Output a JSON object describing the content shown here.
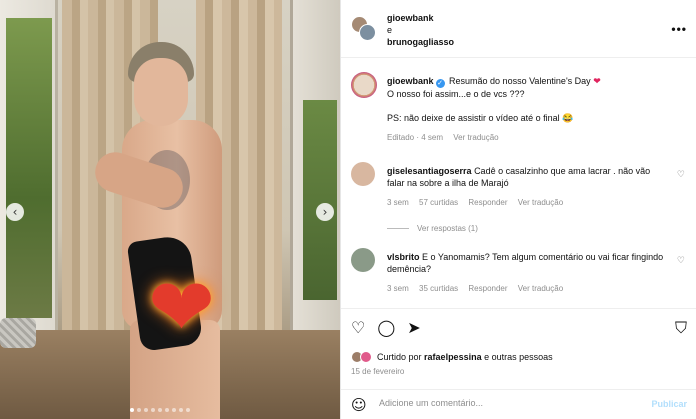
{
  "photo": {
    "prev_icon": "chevron-left-icon",
    "next_icon": "chevron-right-icon",
    "prev_glyph": "‹",
    "next_glyph": "›",
    "sticker_glyph": "❤",
    "sticker_icon": "heart-on-fire-sticker",
    "dot_count": 9,
    "active_dot": 0
  },
  "header": {
    "user1": "gioewbank",
    "connector": "e",
    "user2": "brunogagliasso",
    "more_glyph": "•••"
  },
  "caption": {
    "username": "gioewbank",
    "verified_glyph": "✓",
    "line1": "Resumão do nosso Valentine's Day",
    "heart": "❤",
    "line2": "O nosso foi assim...e o de vcs ???",
    "line3": "PS: não deixe de assistir o vídeo até o final 😂",
    "edited": "Editado · 4 sem",
    "see_translation": "Ver tradução"
  },
  "comments": [
    {
      "username": "giselesantiagoserra",
      "text": "Cadê o casalzinho que ama lacrar . não vão falar na sobre a ilha de Marajó",
      "time": "3 sem",
      "likes": "57 curtidas",
      "reply": "Responder",
      "translate": "Ver tradução",
      "view_replies": "Ver respostas (1)",
      "avatar_color": "#d8b7a0"
    },
    {
      "username": "vlsbrito",
      "text": "E o Yanomamis? Tem algum comentário ou vai ficar fingindo demência?",
      "time": "3 sem",
      "likes": "35 curtidas",
      "reply": "Responder",
      "translate": "Ver tradução",
      "avatar_color": "#8a9a88"
    }
  ],
  "actions": {
    "like_glyph": "♡",
    "comment_glyph": "◯",
    "share_glyph": "➤",
    "save_glyph": "⛉",
    "liked_prefix": "Curtido por",
    "liked_user": "rafaelpessina",
    "liked_suffix": "e outras pessoas",
    "date": "15 de fevereiro",
    "emoji_glyph": "☺",
    "comment_placeholder": "Adicione um comentário...",
    "publish": "Publicar"
  },
  "colors": {
    "accent_blue": "#3897f0",
    "publish_disabled": "#b2dffc",
    "heart_red": "#e0245e"
  }
}
